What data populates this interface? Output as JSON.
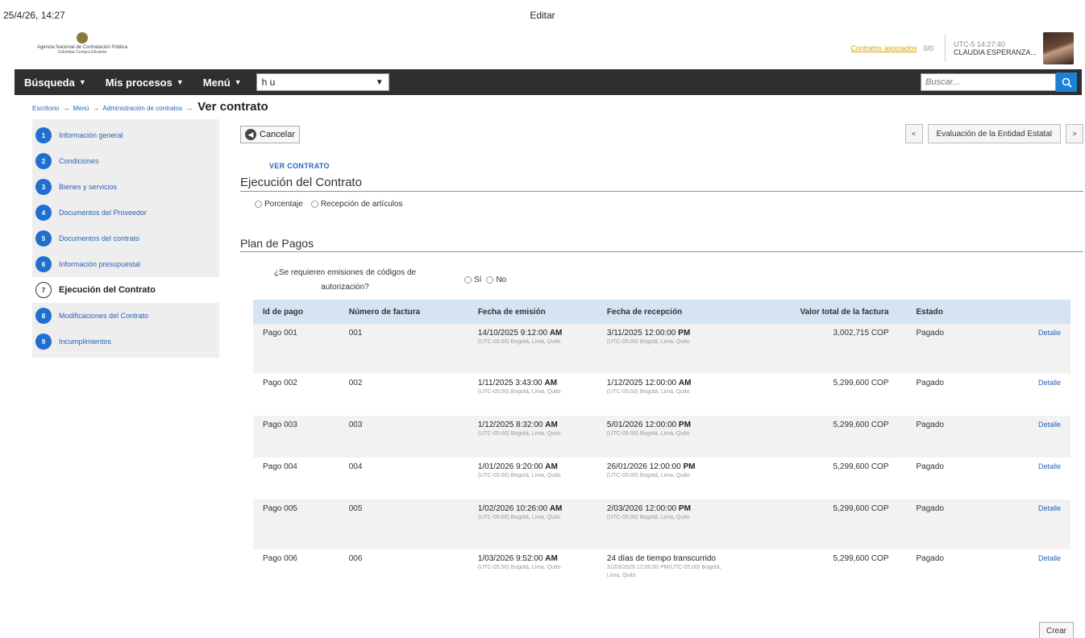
{
  "print_header": {
    "date": "25/4/26, 14:27",
    "title": "Editar"
  },
  "banner": {
    "logo_line1": "Agencia Nacional de Contratación Pública",
    "logo_line2": "Colombia Compra Eficiente",
    "notifications_link": "Contratos asociados",
    "notifications_count": "0/0",
    "timezone": "UTC-5 14:27:40",
    "user_name": "CLAUDIA ESPERANZA..."
  },
  "nav": {
    "busqueda": "Búsqueda",
    "mis_procesos": "Mis procesos",
    "menu": "Menú",
    "select_value": "h u",
    "search_placeholder": "Buscar..."
  },
  "breadcrumb": {
    "items": [
      "Escritorio",
      "Menú",
      "Administración de contratos"
    ],
    "current": "Ver contrato"
  },
  "sidebar": {
    "items": [
      {
        "num": "1",
        "label": "Información general"
      },
      {
        "num": "2",
        "label": "Condiciones"
      },
      {
        "num": "3",
        "label": "Bienes y servicios"
      },
      {
        "num": "4",
        "label": "Documentos del Proveedor"
      },
      {
        "num": "5",
        "label": "Documentos del contrato"
      },
      {
        "num": "6",
        "label": "Información presupuestal"
      },
      {
        "num": "7",
        "label": "Ejecución del Contrato"
      },
      {
        "num": "8",
        "label": "Modificaciones del Contrato"
      },
      {
        "num": "9",
        "label": "Incumplimientos"
      }
    ]
  },
  "toolbar": {
    "cancel_label": "Cancelar",
    "prev_label": "<",
    "next_label": ">",
    "section_nav_label": "Evaluación de la Entidad Estatal"
  },
  "main": {
    "ver_contrato_link": "VER CONTRATO",
    "section_title": "Ejecución del Contrato",
    "radio_porcentaje": "Porcentaje",
    "radio_recepcion": "Recepción de artículos",
    "plan_title": "Plan de Pagos",
    "question": "¿Se requieren emisiones de códigos de autorización?",
    "radio_si": "Sí",
    "radio_no": "No",
    "crear_label": "Crear"
  },
  "table": {
    "headers": [
      "Id de pago",
      "Número de factura",
      "Fecha de emisión",
      "Fecha de recepción",
      "Valor total de la factura",
      "Estado",
      ""
    ],
    "rows": [
      {
        "id": "Pago 001",
        "factura": "001",
        "emision": "14/10/2025 9:12:00 AM",
        "emision_tz": "(UTC-05:00) Bogotá, Lima, Quito",
        "recepcion": "3/11/2025 12:00:00 PM",
        "recepcion_tz": "(UTC-05:00) Bogotá, Lima, Quito",
        "valor": "3,002,715 COP",
        "estado": "Pagado",
        "accion": "Detalle"
      },
      {
        "id": "Pago 002",
        "factura": "002",
        "emision": "1/11/2025 3:43:00 AM",
        "emision_tz": "(UTC-05:00) Bogotá, Lima, Quito",
        "recepcion": "1/12/2025 12:00:00 AM",
        "recepcion_tz": "(UTC-05:00) Bogotá, Lima, Quito",
        "valor": "5,299,600 COP",
        "estado": "Pagado",
        "accion": "Detalle"
      },
      {
        "id": "Pago 003",
        "factura": "003",
        "emision": "1/12/2025 8:32:00 AM",
        "emision_tz": "(UTC-05:00) Bogotá, Lima, Quito",
        "recepcion": "5/01/2026 12:00:00 PM",
        "recepcion_tz": "(UTC-05:00) Bogotá, Lima, Quito",
        "valor": "5,299,600 COP",
        "estado": "Pagado",
        "accion": "Detalle"
      },
      {
        "id": "Pago 004",
        "factura": "004",
        "emision": "1/01/2026 9:20:00 AM",
        "emision_tz": "(UTC-05:00) Bogotá, Lima, Quito",
        "recepcion": "26/01/2026 12:00:00 PM",
        "recepcion_tz": "(UTC-05:00) Bogotá, Lima, Quito",
        "valor": "5,299,600 COP",
        "estado": "Pagado",
        "accion": "Detalle"
      },
      {
        "id": "Pago 005",
        "factura": "005",
        "emision": "1/02/2026 10:26:00 AM",
        "emision_tz": "(UTC-05:00) Bogotá, Lima, Quito",
        "recepcion": "2/03/2026 12:00:00 PM",
        "recepcion_tz": "(UTC-05:00) Bogotá, Lima, Quito",
        "valor": "5,299,600 COP",
        "estado": "Pagado",
        "accion": "Detalle"
      },
      {
        "id": "Pago 006",
        "factura": "006",
        "emision": "1/03/2026 9:52:00 AM",
        "emision_tz": "(UTC-05:00) Bogotá, Lima, Quito",
        "recepcion": "24 días de tiempo transcurrido",
        "recepcion_tz": "31/03/2026 12:00:00 PM(UTC-05:00) Bogotá, Lima, Quito",
        "valor": "5,299,600 COP",
        "estado": "Pagado",
        "accion": "Detalle"
      }
    ]
  }
}
